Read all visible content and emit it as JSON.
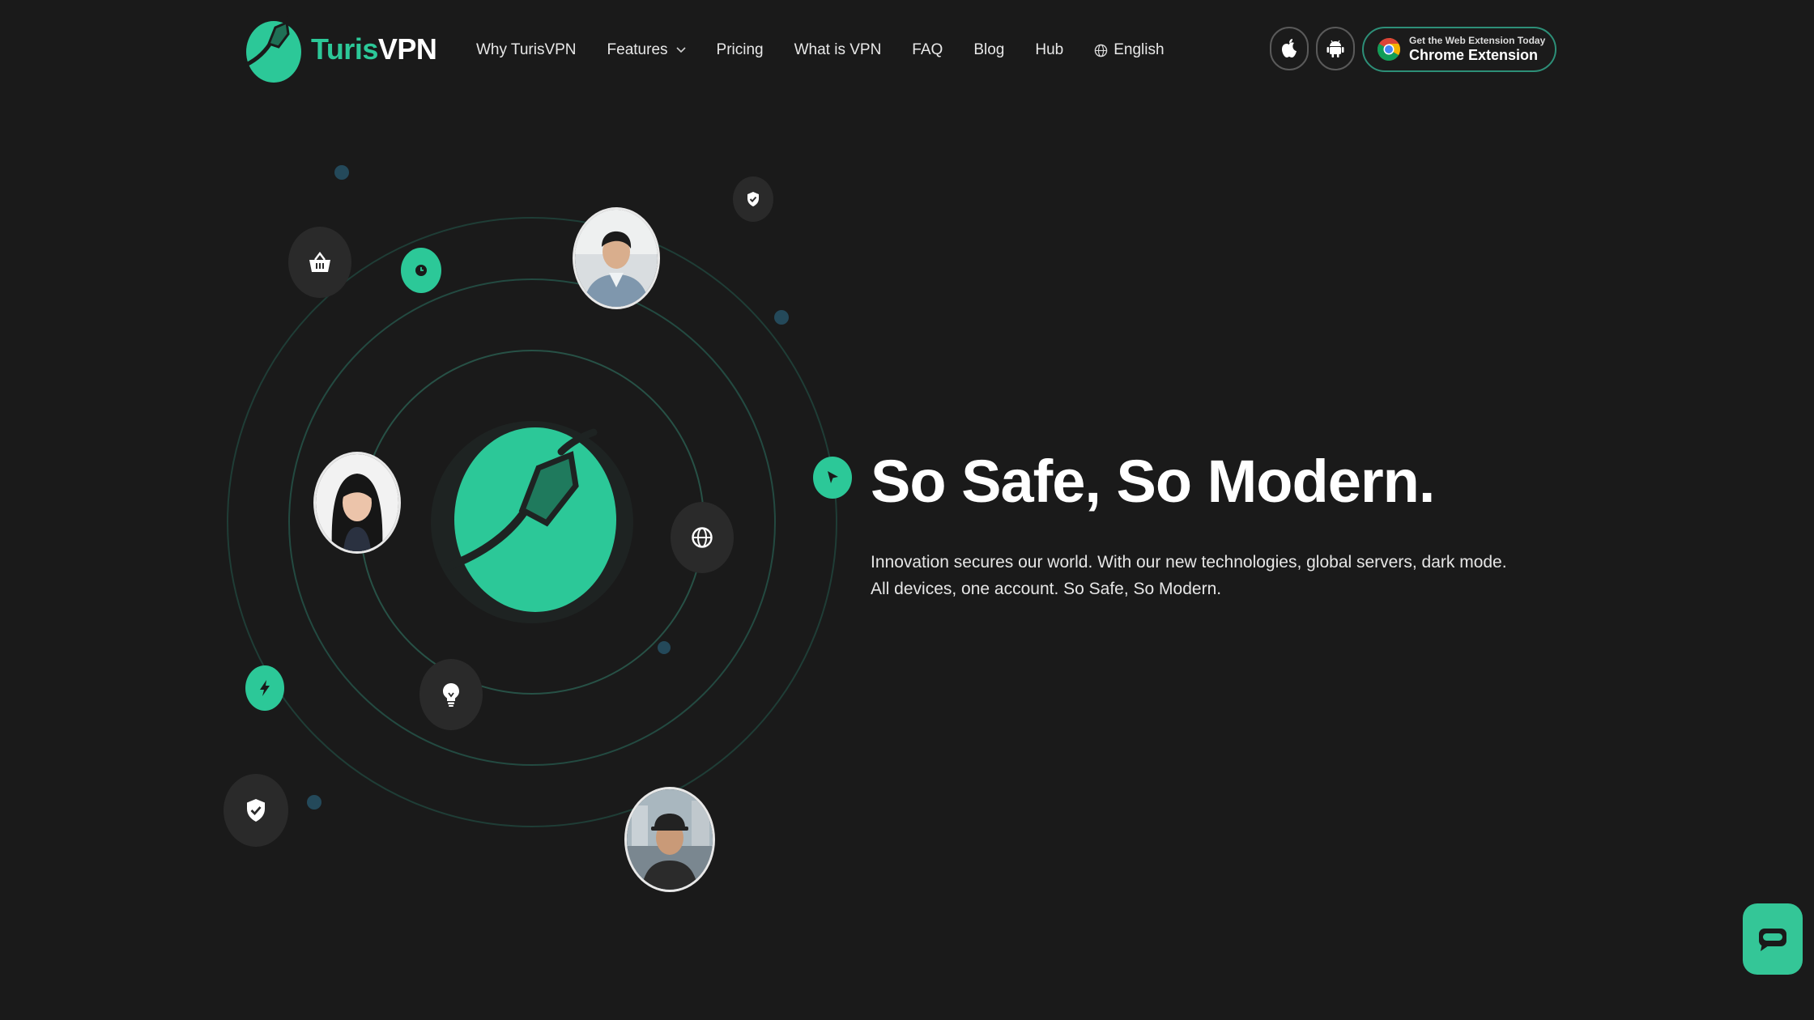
{
  "brand": {
    "name_part1": "Turis",
    "name_part2": "VPN",
    "accent_color": "#2cc898",
    "background_color": "#1a1a1a"
  },
  "nav": {
    "items": [
      {
        "label": "Why TurisVPN",
        "icon": null
      },
      {
        "label": "Features",
        "icon": "chevron-down-icon"
      },
      {
        "label": "Pricing",
        "icon": null
      },
      {
        "label": "What is VPN",
        "icon": null
      },
      {
        "label": "FAQ",
        "icon": null
      },
      {
        "label": "Blog",
        "icon": null
      },
      {
        "label": "Hub",
        "icon": null
      },
      {
        "label": "English",
        "icon": "globe-icon"
      }
    ]
  },
  "header_actions": {
    "apple_icon": "apple-icon",
    "android_icon": "android-icon",
    "chrome_small": "Get the Web Extension Today",
    "chrome_big": "Chrome Extension",
    "chrome_icon": "chrome-icon"
  },
  "hero": {
    "title": "So Safe, So Modern.",
    "line1": "Innovation secures our world. With our new technologies, global servers, dark mode.",
    "line2": "All devices, one account. So Safe, So Modern.",
    "marker_icon": "cursor-arrow-icon"
  },
  "orbit_icons": [
    "basket-icon",
    "clock-icon",
    "shield-check-icon",
    "globe-icon",
    "bolt-icon",
    "lightbulb-icon",
    "shield-check-icon",
    "brand-logo-icon"
  ],
  "chat": {
    "icon": "chat-icon"
  }
}
